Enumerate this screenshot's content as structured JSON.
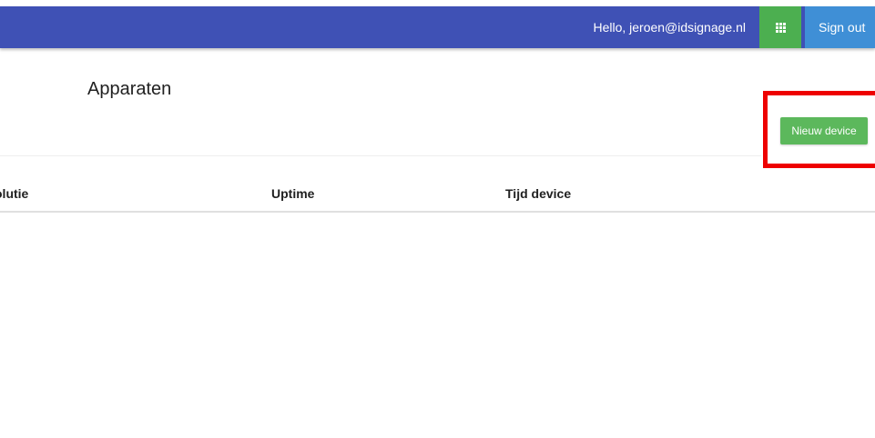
{
  "topbar": {
    "greeting": "Hello, jeroen@idsignage.nl",
    "apps_icon": "apps-grid-icon",
    "signout_label": "Sign out"
  },
  "page": {
    "title": "Apparaten",
    "new_device_label": "Nieuw device"
  },
  "table": {
    "columns": [
      "olutie",
      "Uptime",
      "Tijd device"
    ]
  },
  "colors": {
    "navbar": "#3f51b5",
    "apps_button": "#4caf50",
    "signout_button": "#3f8fd6",
    "new_device_button": "#5cb85c",
    "highlight": "#ee0000"
  }
}
